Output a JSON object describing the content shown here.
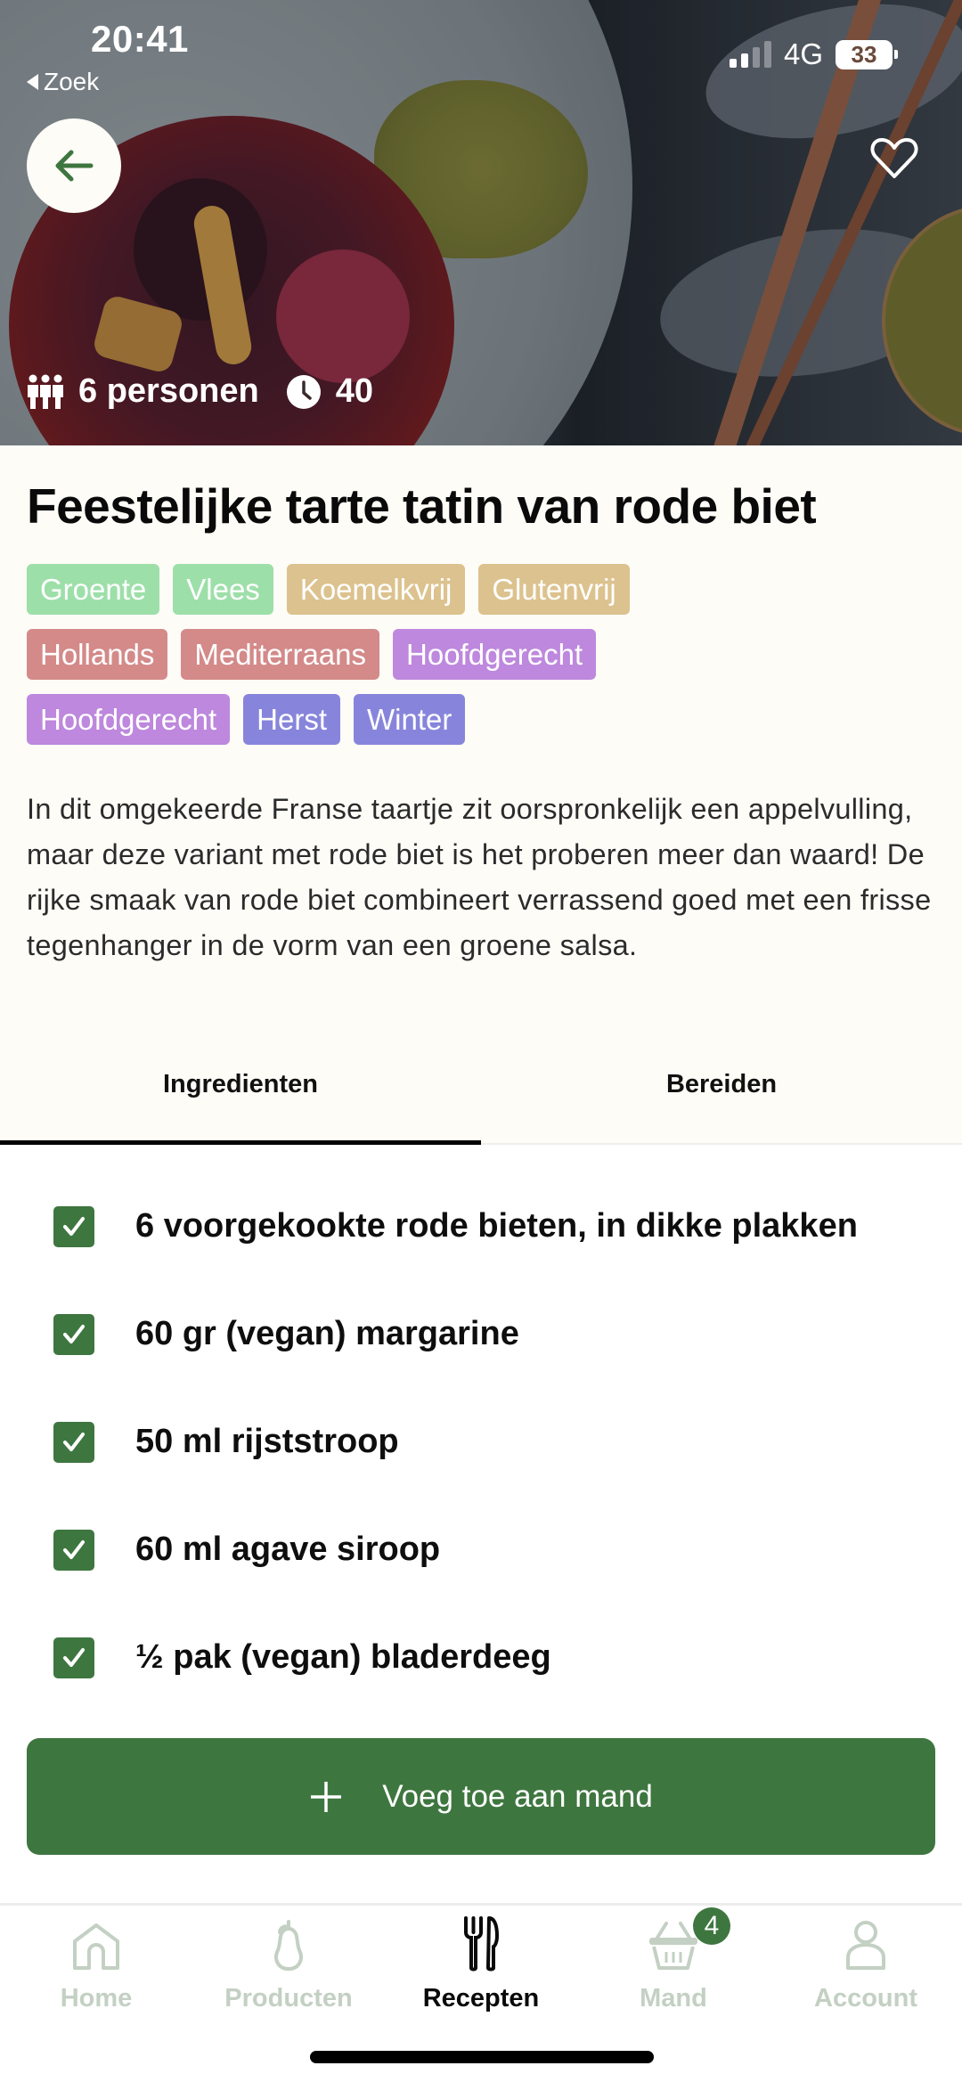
{
  "status_bar": {
    "time": "20:41",
    "back_app": "Zoek",
    "network": "4G",
    "battery": "33",
    "signal_bars_active": 2,
    "signal_bars_total": 4
  },
  "hero": {
    "servings": "6 personen",
    "time": "40",
    "icons": {
      "servings": "people-icon",
      "time": "clock-icon",
      "back": "arrow-left-icon",
      "favorite": "heart-icon"
    }
  },
  "recipe": {
    "title": "Feestelijke tarte tatin van rode biet",
    "tag_rows": [
      [
        {
          "label": "Groente",
          "color": "#9ddfa9"
        },
        {
          "label": "Vlees",
          "color": "#9ddfa9"
        },
        {
          "label": "Koemelkvrij",
          "color": "#dcc28e"
        },
        {
          "label": "Glutenvrij",
          "color": "#dcc28e"
        }
      ],
      [
        {
          "label": "Hollands",
          "color": "#d38a89"
        },
        {
          "label": "Mediterraans",
          "color": "#d38a89"
        },
        {
          "label": "Hoofdgerecht",
          "color": "#bd88dd"
        }
      ],
      [
        {
          "label": "Hoofdgerecht",
          "color": "#bd88dd"
        },
        {
          "label": "Herst",
          "color": "#8785db"
        },
        {
          "label": "Winter",
          "color": "#8785db"
        }
      ]
    ],
    "description": "In dit omgekeerde Franse taartje zit oorspronkelijk een appelvulling, maar deze variant met rode biet is het proberen meer dan waard! De rijke smaak van rode biet combineert verrassend goed met een frisse tegenhanger in de vorm van een groene salsa."
  },
  "tabs": [
    {
      "label": "Ingredienten",
      "active": true
    },
    {
      "label": "Bereiden",
      "active": false
    }
  ],
  "ingredients": [
    {
      "text": "6 voorgekookte rode bieten, in dikke plakken",
      "checked": true
    },
    {
      "text": "60 gr (vegan) margarine",
      "checked": true
    },
    {
      "text": "50 ml rijststroop",
      "checked": true
    },
    {
      "text": "60 ml agave siroop",
      "checked": true
    },
    {
      "text": "½ pak (vegan) bladerdeeg",
      "checked": true
    }
  ],
  "add_to_cart": {
    "label": "Voeg toe aan mand",
    "icon": "plus-icon"
  },
  "bottom_nav": {
    "items": [
      {
        "label": "Home",
        "icon": "home-icon",
        "active": false
      },
      {
        "label": "Producten",
        "icon": "pear-icon",
        "active": false
      },
      {
        "label": "Recepten",
        "icon": "cutlery-icon",
        "active": true
      },
      {
        "label": "Mand",
        "icon": "basket-icon",
        "active": false,
        "badge": "4"
      },
      {
        "label": "Account",
        "icon": "user-icon",
        "active": false
      }
    ]
  },
  "colors": {
    "brand_green": "#3e763f",
    "cream_bg": "#fdfcf7",
    "nav_inactive": "#c3d0c3"
  }
}
